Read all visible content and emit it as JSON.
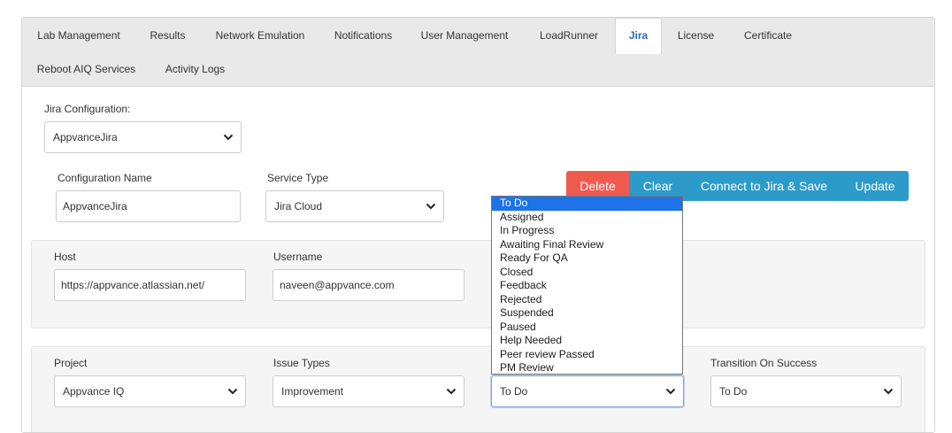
{
  "tabs": [
    {
      "label": "Lab Management"
    },
    {
      "label": "Results"
    },
    {
      "label": "Network Emulation"
    },
    {
      "label": "Notifications"
    },
    {
      "label": "User Management"
    },
    {
      "label": "LoadRunner"
    },
    {
      "label": "Jira",
      "active": true
    },
    {
      "label": "License"
    },
    {
      "label": "Certificate"
    },
    {
      "label": "Reboot AIQ Services"
    },
    {
      "label": "Activity Logs"
    }
  ],
  "jira_configuration": {
    "label": "Jira Configuration:",
    "value": "AppvanceJira"
  },
  "configuration_name": {
    "label": "Configuration Name",
    "value": "AppvanceJira"
  },
  "service_type": {
    "label": "Service Type",
    "value": "Jira Cloud"
  },
  "buttons": {
    "delete": "Delete",
    "clear": "Clear",
    "connect_save": "Connect to Jira & Save",
    "update": "Update"
  },
  "host": {
    "label": "Host",
    "value": "https://appvance.atlassian.net/"
  },
  "username": {
    "label": "Username",
    "value": "naveen@appvance.com"
  },
  "project": {
    "label": "Project",
    "value": "Appvance IQ"
  },
  "issue_types": {
    "label": "Issue Types",
    "value": "Improvement"
  },
  "transition_select": {
    "value": "To Do"
  },
  "transition_on_success": {
    "label": "Transition On Success",
    "value": "To Do"
  },
  "status_dropdown": {
    "selected": "To Do",
    "options": [
      "To Do",
      "Assigned",
      "In Progress",
      "Awaiting Final Review",
      "Ready For QA",
      "Closed",
      "Feedback",
      "Rejected",
      "Suspended",
      "Paused",
      "Help Needed",
      "Peer review Passed",
      "PM Review"
    ]
  },
  "colors": {
    "active_tab_text": "#2a6fb0",
    "delete_button": "#ef5a4f",
    "action_button": "#2d9bc9",
    "dropdown_highlight": "#1e73e8"
  },
  "icons": {
    "select_caret": "chevron-down-icon"
  }
}
